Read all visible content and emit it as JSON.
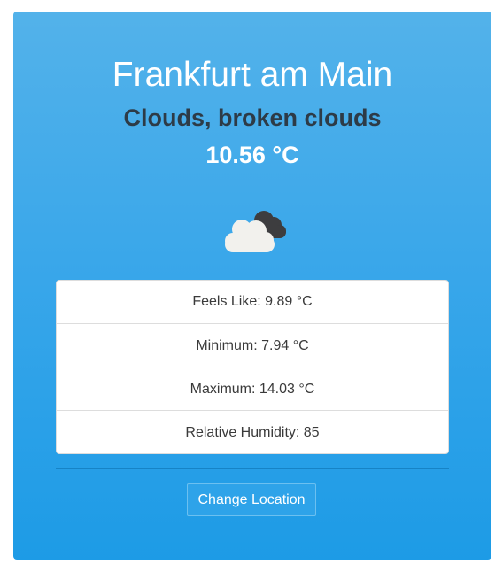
{
  "weather": {
    "city": "Frankfurt am Main",
    "condition": "Clouds, broken clouds",
    "temperature": "10.56 °C",
    "icon": "broken-clouds-icon"
  },
  "details": [
    {
      "label": "Feels Like: 9.89 °C"
    },
    {
      "label": "Minimum: 7.94 °C"
    },
    {
      "label": "Maximum: 14.03 °C"
    },
    {
      "label": "Relative Humidity: 85"
    }
  ],
  "actions": {
    "change_location_label": "Change Location"
  },
  "colors": {
    "card_top": "#53b2ea",
    "card_bottom": "#1d9be6",
    "condition_text": "#2d3b47",
    "cloud_light": "#f2f1ed",
    "cloud_dark": "#3d3d3f"
  }
}
